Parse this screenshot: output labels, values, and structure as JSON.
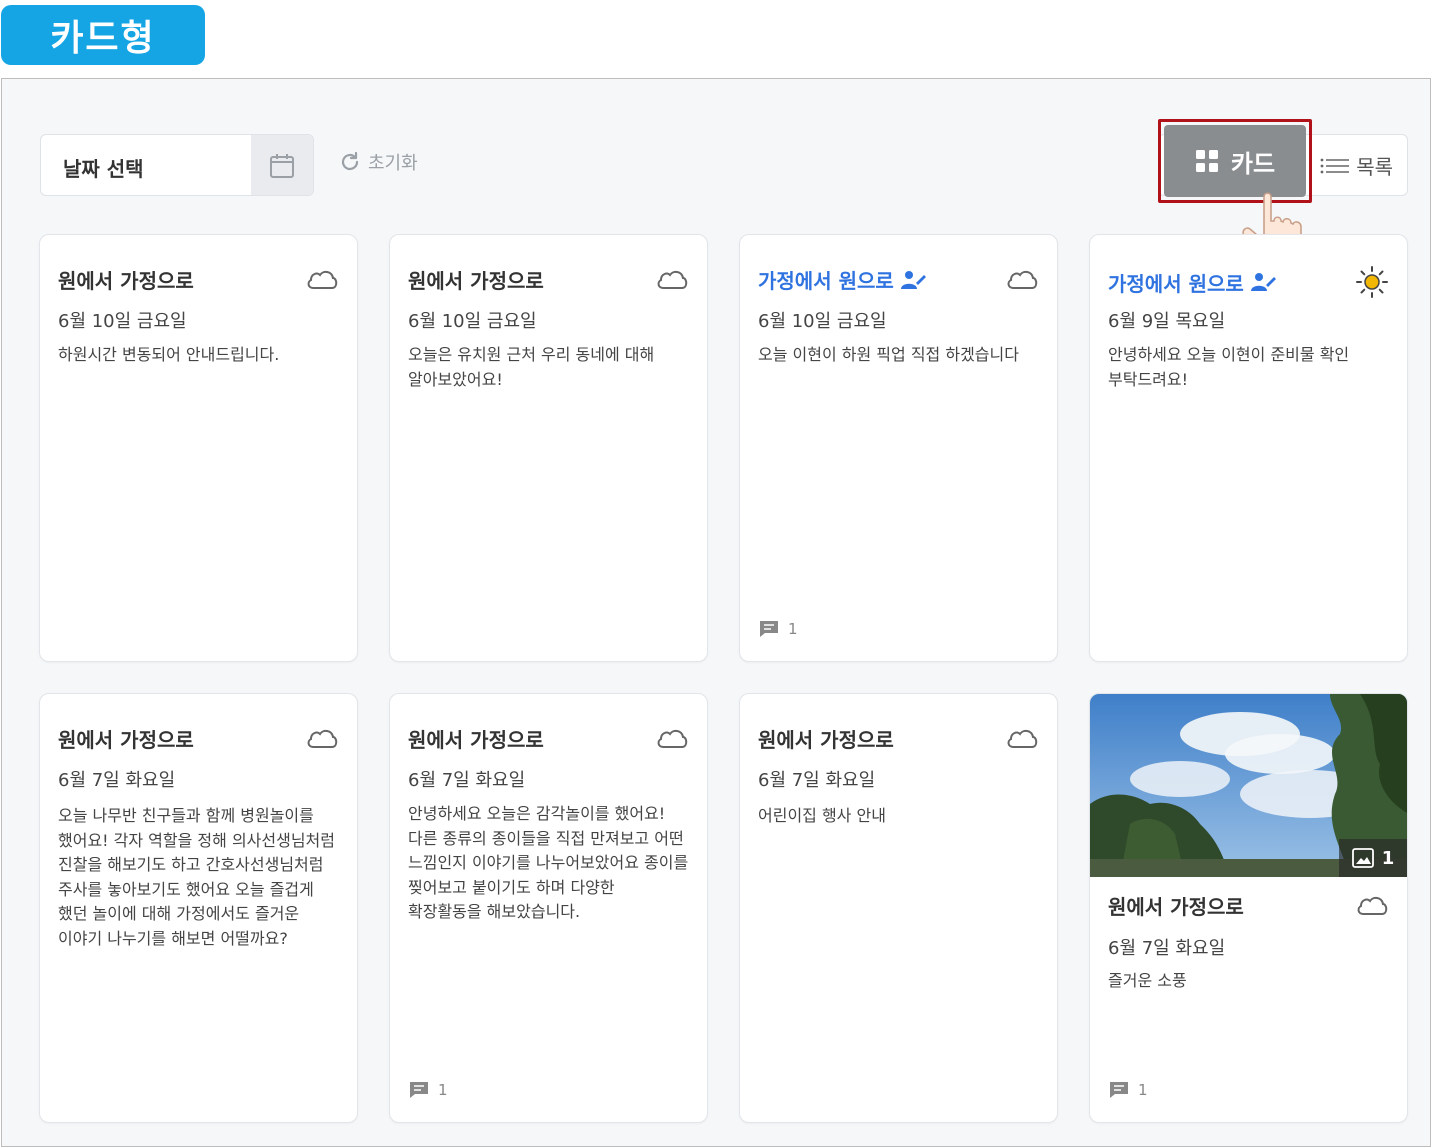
{
  "badge": {
    "label": "카드형"
  },
  "toolbar": {
    "date_placeholder": "날짜 선택",
    "reset_label": "초기화",
    "view_card_label": "카드",
    "view_list_label": "목록"
  },
  "colors": {
    "badge": "#16a5e4",
    "accent_blue": "#2f73e0",
    "highlight_border": "#b1121a",
    "active_button": "#8a8d90",
    "sun": "#f2b705"
  },
  "cards": [
    {
      "title": "원에서 가정으로",
      "direction": "school-to-home",
      "date": "6월 10일 금요일",
      "weather": "cloud-icon",
      "body": "하원시간 변동되어 안내드립니다.",
      "comments": ""
    },
    {
      "title": "원에서 가정으로",
      "direction": "school-to-home",
      "date": "6월 10일 금요일",
      "weather": "cloud-icon",
      "body": "오늘은 유치원 근처 우리 동네에 대해 알아보았어요!",
      "comments": ""
    },
    {
      "title": "가정에서 원으로",
      "direction": "home-to-school",
      "date": "6월 10일 금요일",
      "weather": "cloud-icon",
      "body": "오늘 이현이 하원 픽업 직접 하겠습니다",
      "comments": "1"
    },
    {
      "title": "가정에서 원으로",
      "direction": "home-to-school",
      "date": "6월 9일 목요일",
      "weather": "sun-icon",
      "body": "안녕하세요 오늘 이현이 준비물 확인 부탁드려요!",
      "comments": ""
    },
    {
      "title": "원에서 가정으로",
      "direction": "school-to-home",
      "date": "6월 7일 화요일",
      "weather": "cloud-icon",
      "body": "오늘 나무반 친구들과 함께 병원놀이를 했어요! 각자 역할을 정해 의사선생님처럼 진찰을 해보기도 하고 간호사선생님처럼 주사를 놓아보기도 했어요 오늘 즐겁게 했던 놀이에 대해 가정에서도 즐거운 이야기 나누기를 해보면 어떨까요?",
      "comments": ""
    },
    {
      "title": "원에서 가정으로",
      "direction": "school-to-home",
      "date": "6월 7일 화요일",
      "weather": "cloud-icon",
      "body": "안녕하세요 오늘은 감각놀이를 했어요! 다른 종류의 종이들을 직접 만져보고 어떤 느낌인지 이야기를 나누어보았어요 종이를 찢어보고 붙이기도 하며 다양한 확장활동을 해보았습니다.",
      "comments": "1"
    },
    {
      "title": "원에서 가정으로",
      "direction": "school-to-home",
      "date": "6월 7일 화요일",
      "weather": "cloud-icon",
      "body": "어린이집 행사 안내",
      "comments": ""
    },
    {
      "title": "원에서 가정으로",
      "direction": "school-to-home",
      "date": "6월 7일 화요일",
      "weather": "cloud-icon",
      "body": "즐거운 소풍",
      "comments": "1",
      "photo_count": "1"
    }
  ]
}
